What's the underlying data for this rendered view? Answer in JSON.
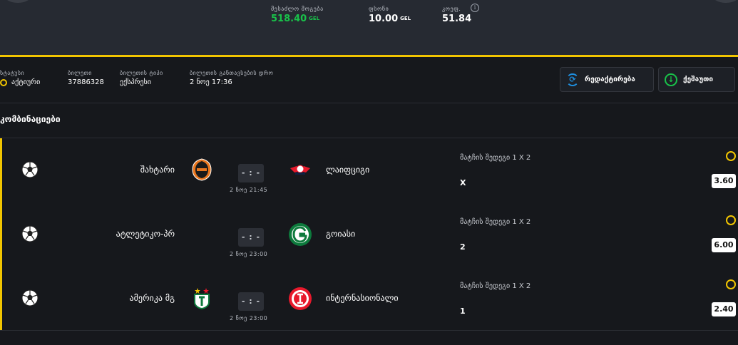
{
  "summary": {
    "potential_label": "მესაძლო მოგება",
    "potential_value": "518.40",
    "potential_currency": "GEL",
    "stake_label": "ფსონი",
    "stake_value": "10.00",
    "stake_currency": "GEL",
    "coef_label": "კოეფ.",
    "coef_value": "51.84",
    "info_symbol": "i"
  },
  "ticket": {
    "status_label": "სტატუსი",
    "status_value": "აქტიური",
    "id_label": "ბილეთი",
    "id_value": "37886328",
    "type_label": "ბილეთის ტიპი",
    "type_value": "ექსპრესი",
    "time_label": "ბილეთის განთავსების დრო",
    "time_value": "2 ნოე 17:36"
  },
  "actions": {
    "edit_label": "რედაქტირება",
    "save_label": "ქეშაუთი"
  },
  "section_title": "კომბინაციები",
  "matches": [
    {
      "home": "შახტარი",
      "away": "ლაიფციგი",
      "score": "- : -",
      "date": "2 ნოე 21:45",
      "market": "მატჩის შედეგი 1 X 2",
      "pick": "X",
      "odd": "3.60"
    },
    {
      "home": "ატლეტიკო-პრ",
      "away": "გოიასი",
      "score": "- : -",
      "date": "2 ნოე 23:00",
      "market": "მატჩის შედეგი 1 X 2",
      "pick": "2",
      "odd": "6.00"
    },
    {
      "home": "ამერიკა მგ",
      "away": "ინტერნასიონალი",
      "score": "- : -",
      "date": "2 ნოე 23:00",
      "market": "მატჩის შედეგი 1 X 2",
      "pick": "1",
      "odd": "2.40"
    }
  ],
  "colors": {
    "accent_yellow": "#f2c500",
    "win_green": "#19c24a",
    "edit_blue": "#1e8fe0",
    "background": "#16181c",
    "header_bg": "#262a32"
  }
}
